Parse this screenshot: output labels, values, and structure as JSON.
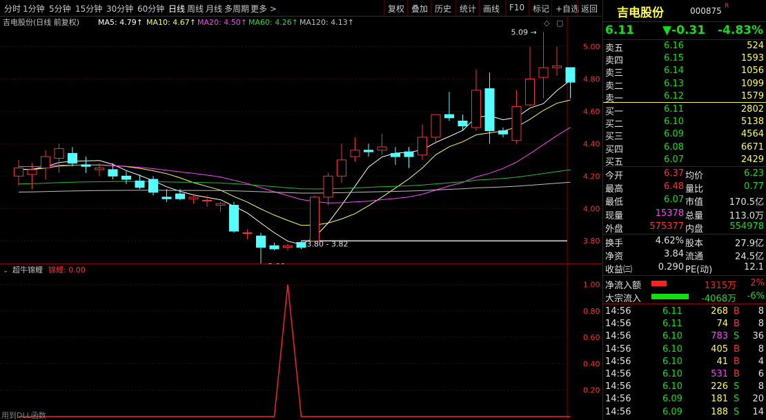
{
  "toolbar": {
    "periods": [
      "分时",
      "1分钟",
      "5分钟",
      "15分钟",
      "30分钟",
      "60分钟",
      "日线",
      "周线",
      "月线",
      "多周期",
      "更多 >"
    ],
    "active_period": "日线",
    "actions": [
      "复权",
      "叠加",
      "历史",
      "统计",
      "画线",
      "F10",
      "标记",
      "+自选",
      "返回"
    ]
  },
  "main_chart": {
    "title": "吉电股份(日线 前复权)",
    "ma_labels": [
      {
        "text": "MA5: 4.79↑",
        "color": "#ffffff"
      },
      {
        "text": "MA10: 4.67↑",
        "color": "#ffff40"
      },
      {
        "text": "MA20: 4.50↑",
        "color": "#ff40ff"
      },
      {
        "text": "MA60: 4.26↑",
        "color": "#20e020"
      },
      {
        "text": "MA120: 4.13↑",
        "color": "#c0c0c0"
      }
    ],
    "annotations": {
      "high": "5.09",
      "low": "3.66",
      "range": "3.80 - 3.82"
    },
    "y_ticks": [
      "5.00",
      "4.80",
      "4.60",
      "4.40",
      "4.20",
      "4.00",
      "3.80"
    ]
  },
  "chart_data": [
    {
      "type": "candlestick",
      "title": "吉电股份(日线 前复权)",
      "ylim": [
        3.72,
        5.13
      ],
      "candles": [
        {
          "o": 4.2,
          "h": 4.3,
          "l": 4.14,
          "c": 4.25
        },
        {
          "o": 4.21,
          "h": 4.28,
          "l": 4.12,
          "c": 4.24
        },
        {
          "o": 4.25,
          "h": 4.36,
          "l": 4.18,
          "c": 4.32
        },
        {
          "o": 4.31,
          "h": 4.4,
          "l": 4.22,
          "c": 4.37
        },
        {
          "o": 4.34,
          "h": 4.38,
          "l": 4.26,
          "c": 4.28
        },
        {
          "o": 4.27,
          "h": 4.32,
          "l": 4.22,
          "c": 4.26
        },
        {
          "o": 4.24,
          "h": 4.28,
          "l": 4.2,
          "c": 4.25
        },
        {
          "o": 4.24,
          "h": 4.28,
          "l": 4.18,
          "c": 4.2
        },
        {
          "o": 4.2,
          "h": 4.23,
          "l": 4.15,
          "c": 4.18
        },
        {
          "o": 4.17,
          "h": 4.21,
          "l": 4.12,
          "c": 4.13
        },
        {
          "o": 4.18,
          "h": 4.2,
          "l": 4.08,
          "c": 4.1
        },
        {
          "o": 4.07,
          "h": 4.12,
          "l": 4.04,
          "c": 4.06
        },
        {
          "o": 4.09,
          "h": 4.12,
          "l": 4.05,
          "c": 4.06
        },
        {
          "o": 4.06,
          "h": 4.09,
          "l": 4.03,
          "c": 4.07
        },
        {
          "o": 4.05,
          "h": 4.08,
          "l": 4.01,
          "c": 4.05
        },
        {
          "o": 4.02,
          "h": 4.04,
          "l": 3.98,
          "c": 4.03
        },
        {
          "o": 4.02,
          "h": 4.04,
          "l": 3.85,
          "c": 3.86
        },
        {
          "o": 3.85,
          "h": 3.87,
          "l": 3.81,
          "c": 3.85
        },
        {
          "o": 3.83,
          "h": 3.85,
          "l": 3.66,
          "c": 3.76
        },
        {
          "o": 3.77,
          "h": 3.79,
          "l": 3.74,
          "c": 3.75
        },
        {
          "o": 3.76,
          "h": 3.78,
          "l": 3.74,
          "c": 3.77
        },
        {
          "o": 3.79,
          "h": 3.8,
          "l": 3.75,
          "c": 3.76
        },
        {
          "o": 3.8,
          "h": 4.08,
          "l": 3.8,
          "c": 4.07
        },
        {
          "o": 4.07,
          "h": 4.22,
          "l": 4.02,
          "c": 4.2
        },
        {
          "o": 4.2,
          "h": 4.4,
          "l": 4.16,
          "c": 4.3
        },
        {
          "o": 4.32,
          "h": 4.44,
          "l": 4.29,
          "c": 4.36
        },
        {
          "o": 4.36,
          "h": 4.4,
          "l": 4.32,
          "c": 4.35
        },
        {
          "o": 4.36,
          "h": 4.46,
          "l": 4.33,
          "c": 4.38
        },
        {
          "o": 4.34,
          "h": 4.38,
          "l": 4.27,
          "c": 4.32
        },
        {
          "o": 4.35,
          "h": 4.38,
          "l": 4.25,
          "c": 4.32
        },
        {
          "o": 4.33,
          "h": 4.52,
          "l": 4.3,
          "c": 4.44
        },
        {
          "o": 4.44,
          "h": 4.58,
          "l": 4.4,
          "c": 4.58
        },
        {
          "o": 4.58,
          "h": 4.72,
          "l": 4.54,
          "c": 4.56
        },
        {
          "o": 4.54,
          "h": 4.58,
          "l": 4.48,
          "c": 4.51
        },
        {
          "o": 4.5,
          "h": 4.86,
          "l": 4.48,
          "c": 4.73
        },
        {
          "o": 4.74,
          "h": 4.84,
          "l": 4.4,
          "c": 4.48
        },
        {
          "o": 4.48,
          "h": 4.5,
          "l": 4.44,
          "c": 4.46
        },
        {
          "o": 4.42,
          "h": 4.73,
          "l": 4.4,
          "c": 4.63
        },
        {
          "o": 4.64,
          "h": 5.0,
          "l": 4.63,
          "c": 4.8
        },
        {
          "o": 4.81,
          "h": 5.09,
          "l": 4.68,
          "c": 4.87
        },
        {
          "o": 4.87,
          "h": 5.0,
          "l": 4.82,
          "c": 4.88
        },
        {
          "o": 4.87,
          "h": 4.87,
          "l": 4.68,
          "c": 4.78
        }
      ]
    },
    {
      "type": "line",
      "title": "超牛锦鲤",
      "series": [
        {
          "name": "锦鲤",
          "values": [
            0,
            0,
            0,
            0,
            0,
            0,
            0,
            0,
            0,
            0,
            0,
            0,
            0,
            0,
            0,
            0,
            0,
            0,
            0,
            0,
            1,
            0,
            0,
            0,
            0,
            0,
            0,
            0,
            0,
            0,
            0,
            0,
            0,
            0,
            0,
            0,
            0,
            0,
            0,
            0,
            0,
            0
          ]
        }
      ],
      "ylim": [
        0,
        1.05
      ],
      "y_ticks": [
        "1.00",
        "0.80",
        "0.60",
        "0.40",
        "0.20"
      ]
    }
  ],
  "indicator": {
    "title": "超牛锦鲤",
    "series_label": "锦鲤: 0.00",
    "footer": "用到DLL函数"
  },
  "quote": {
    "name": "吉电股份",
    "code": "000875",
    "flag": "R",
    "price": "6.11",
    "change": "▼-0.31",
    "pct": "-4.83%",
    "asks": [
      {
        "label": "卖五",
        "price": "6.16",
        "vol": "524"
      },
      {
        "label": "卖四",
        "price": "6.15",
        "vol": "1593"
      },
      {
        "label": "卖三",
        "price": "6.14",
        "vol": "1056"
      },
      {
        "label": "卖二",
        "price": "6.13",
        "vol": "1099"
      },
      {
        "label": "卖一",
        "price": "6.12",
        "vol": "1579"
      }
    ],
    "bids": [
      {
        "label": "买一",
        "price": "6.11",
        "vol": "2802"
      },
      {
        "label": "买二",
        "price": "6.10",
        "vol": "5138"
      },
      {
        "label": "买三",
        "price": "6.09",
        "vol": "4564"
      },
      {
        "label": "买四",
        "price": "6.08",
        "vol": "6671"
      },
      {
        "label": "买五",
        "price": "6.07",
        "vol": "2429"
      }
    ],
    "stats": [
      {
        "l1": "今开",
        "v1": "6.37",
        "c1": "#ff3030",
        "l2": "均价",
        "v2": "6.23",
        "c2": "#10e010"
      },
      {
        "l1": "最高",
        "v1": "6.48",
        "c1": "#ff3030",
        "l2": "量比",
        "v2": "0.77",
        "c2": "#10e010"
      },
      {
        "l1": "最低",
        "v1": "6.07",
        "c1": "#10e010",
        "l2": "市值",
        "v2": "170.5亿",
        "c2": "#e0e0e0"
      },
      {
        "l1": "现量",
        "v1": "15378",
        "c1": "#ff40ff",
        "l2": "总量",
        "v2": "113.0万",
        "c2": "#e0e0e0"
      },
      {
        "l1": "外盘",
        "v1": "575377",
        "c1": "#ff3030",
        "l2": "内盘",
        "v2": "554978",
        "c2": "#10e010"
      }
    ],
    "fundamentals": [
      {
        "l1": "换手",
        "v1": "4.62%",
        "l2": "股本",
        "v2": "27.9亿"
      },
      {
        "l1": "净资",
        "v1": "3.84",
        "l2": "流通",
        "v2": "24.5亿"
      },
      {
        "l1": "收益㈢",
        "v1": "0.290",
        "l2": "PE(动)",
        "v2": "12.1"
      }
    ],
    "flows": [
      {
        "label": "净流入额",
        "value": "1315万",
        "pct": "2%",
        "color": "#ff2020",
        "bar": 0.4
      },
      {
        "label": "大宗流入",
        "value": "-4068万",
        "pct": "-6%",
        "color": "#10e010",
        "bar": 1.0
      }
    ],
    "ticks": [
      {
        "t": "14:56",
        "p": "6.11",
        "v": "268",
        "bs": "B",
        "n": "8",
        "vc": "#ffff40"
      },
      {
        "t": "14:56",
        "p": "6.11",
        "v": "74",
        "bs": "B",
        "n": "8",
        "vc": "#ffff40"
      },
      {
        "t": "14:56",
        "p": "6.10",
        "v": "783",
        "bs": "S",
        "n": "36",
        "vc": "#ff40ff"
      },
      {
        "t": "14:56",
        "p": "6.10",
        "v": "405",
        "bs": "B",
        "n": "8",
        "vc": "#ffff40"
      },
      {
        "t": "14:56",
        "p": "6.10",
        "v": "41",
        "bs": "B",
        "n": "4",
        "vc": "#ffff40"
      },
      {
        "t": "14:56",
        "p": "6.10",
        "v": "531",
        "bs": "B",
        "n": "6",
        "vc": "#ff40ff"
      },
      {
        "t": "14:56",
        "p": "6.10",
        "v": "226",
        "bs": "S",
        "n": "8",
        "vc": "#ffff40"
      },
      {
        "t": "14:56",
        "p": "6.09",
        "v": "181",
        "bs": "S",
        "n": "20",
        "vc": "#ffff40"
      },
      {
        "t": "14:56",
        "p": "6.09",
        "v": "188",
        "bs": "S",
        "n": "14",
        "vc": "#ffff40"
      }
    ]
  }
}
